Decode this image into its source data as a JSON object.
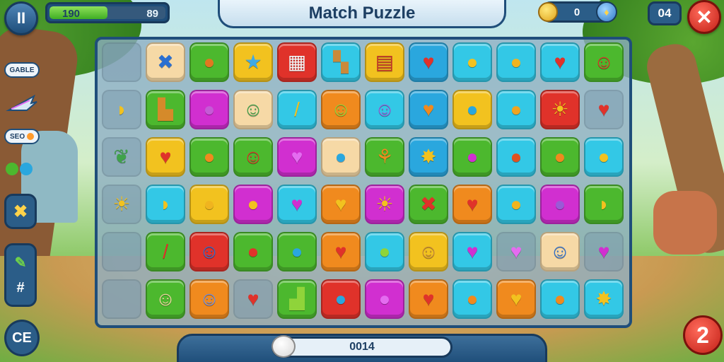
{
  "header": {
    "title": "Match Puzzle",
    "pause_label": "II",
    "progress": {
      "current": "190",
      "max": "89",
      "fill_fraction": 0.5
    },
    "coins": "0",
    "moves": "04",
    "close_label": "✕"
  },
  "sidebar": {
    "pill_top": "GABLE",
    "pill_mid": "SEO",
    "btn_lower_label": "CE"
  },
  "footer": {
    "score": "0014",
    "level": "2"
  },
  "colors": {
    "accent": "#1f4e7a",
    "red": "#e0322a",
    "green": "#4cb82e",
    "yellow": "#f2c21f",
    "blue": "#2aa7de",
    "cyan": "#33c8e6",
    "orange": "#f08a1e",
    "magenta": "#d12fd0",
    "peach": "#f6d9a6",
    "lime": "#8fd43a"
  },
  "board": {
    "cols": 12,
    "rows": [
      [
        {
          "bg": "empty"
        },
        {
          "bg": "peach",
          "icon": "✖",
          "c": "#2a6fd1",
          "name": "cross-icon"
        },
        {
          "bg": "green",
          "icon": "●",
          "c": "#e07820",
          "name": "orange-candy-icon"
        },
        {
          "bg": "yellow",
          "icon": "★",
          "c": "#3fa9e6",
          "name": "star-icon"
        },
        {
          "bg": "red",
          "icon": "▦",
          "c": "#f4f4f4",
          "name": "crate-icon"
        },
        {
          "bg": "cyan",
          "icon": "▚",
          "c": "#c98a3a",
          "name": "map-icon"
        },
        {
          "bg": "yellow",
          "icon": "▤",
          "c": "#c2342a",
          "name": "chest-icon"
        },
        {
          "bg": "blue",
          "icon": "♥",
          "c": "#e0322a",
          "name": "heart-icon"
        },
        {
          "bg": "cyan",
          "icon": "●",
          "c": "#f2c21f",
          "name": "yellow-candy-icon"
        },
        {
          "bg": "cyan",
          "icon": "●",
          "c": "#f0b41f",
          "name": "lemon-icon"
        },
        {
          "bg": "cyan",
          "icon": "♥",
          "c": "#e0322a",
          "name": "heart-icon"
        },
        {
          "bg": "green",
          "icon": "☺",
          "c": "#e0322a",
          "name": "red-creature-icon"
        }
      ],
      [
        {
          "bg": "empty",
          "icon": "◗",
          "c": "#f2c21f",
          "name": "banana-icon"
        },
        {
          "bg": "green",
          "icon": "▙",
          "c": "#d58a2a",
          "name": "bucket-icon"
        },
        {
          "bg": "magenta",
          "icon": "●",
          "c": "#c55bd6",
          "name": "lollipop-icon"
        },
        {
          "bg": "peach",
          "icon": "☺",
          "c": "#3fa34a",
          "name": "green-creature-icon"
        },
        {
          "bg": "cyan",
          "icon": "/",
          "c": "#f2c21f",
          "name": "pencil-icon"
        },
        {
          "bg": "orange",
          "icon": "☺",
          "c": "#8fd43a",
          "name": "lime-creature-icon"
        },
        {
          "bg": "cyan",
          "icon": "☺",
          "c": "#9a5ad6",
          "name": "purple-creature-icon"
        },
        {
          "bg": "blue",
          "icon": "♥",
          "c": "#f08a1e",
          "name": "orange-heart-icon"
        },
        {
          "bg": "yellow",
          "icon": "●",
          "c": "#2aa7de",
          "name": "blue-lollipop-icon"
        },
        {
          "bg": "cyan",
          "icon": "●",
          "c": "#f0a41f",
          "name": "orange-candy-icon"
        },
        {
          "bg": "red",
          "icon": "☀",
          "c": "#f2c21f",
          "name": "sun-icon"
        },
        {
          "bg": "empty",
          "icon": "♥",
          "c": "#e0322a",
          "name": "heart-icon"
        }
      ],
      [
        {
          "bg": "empty",
          "icon": "❦",
          "c": "#3fa34a",
          "name": "flower-icon"
        },
        {
          "bg": "yellow",
          "icon": "♥",
          "c": "#e0322a",
          "name": "heart-icon"
        },
        {
          "bg": "green",
          "icon": "●",
          "c": "#f08a1e",
          "name": "orange-icon"
        },
        {
          "bg": "green",
          "icon": "☺",
          "c": "#e0322a",
          "name": "red-creature-icon"
        },
        {
          "bg": "magenta",
          "icon": "♥",
          "c": "#e46cf0",
          "name": "pink-heart-icon"
        },
        {
          "bg": "peach",
          "icon": "●",
          "c": "#2aa7de",
          "name": "blue-candy-icon"
        },
        {
          "bg": "green",
          "icon": "⚘",
          "c": "#f08a1e",
          "name": "leaf-icon"
        },
        {
          "bg": "blue",
          "icon": "✸",
          "c": "#f2c21f",
          "name": "yellow-burst-icon"
        },
        {
          "bg": "green",
          "icon": "●",
          "c": "#d12fd0",
          "name": "magenta-lollipop-icon"
        },
        {
          "bg": "cyan",
          "icon": "●",
          "c": "#e0521f",
          "name": "orange-lollipop-icon"
        },
        {
          "bg": "green",
          "icon": "●",
          "c": "#f08a1e",
          "name": "orange-candy-icon"
        },
        {
          "bg": "cyan",
          "icon": "●",
          "c": "#f2c21f",
          "name": "lemon-icon"
        }
      ],
      [
        {
          "bg": "empty",
          "icon": "☀",
          "c": "#f2c21f",
          "name": "sun-icon"
        },
        {
          "bg": "cyan",
          "icon": "◗",
          "c": "#f2c21f",
          "name": "banana-icon"
        },
        {
          "bg": "yellow",
          "icon": "●",
          "c": "#f0b41f",
          "name": "bell-icon"
        },
        {
          "bg": "magenta",
          "icon": "●",
          "c": "#f2c21f",
          "name": "apple-icon"
        },
        {
          "bg": "cyan",
          "icon": "♥",
          "c": "#d12fd0",
          "name": "pink-heart-icon"
        },
        {
          "bg": "orange",
          "icon": "♥",
          "c": "#f2c21f",
          "name": "yellow-heart-icon"
        },
        {
          "bg": "magenta",
          "icon": "☀",
          "c": "#f2c21f",
          "name": "sun-icon"
        },
        {
          "bg": "green",
          "icon": "✖",
          "c": "#e0322a",
          "name": "cross-icon"
        },
        {
          "bg": "orange",
          "icon": "♥",
          "c": "#e0322a",
          "name": "heart-icon"
        },
        {
          "bg": "cyan",
          "icon": "●",
          "c": "#f0b41f",
          "name": "lemon-icon"
        },
        {
          "bg": "magenta",
          "icon": "●",
          "c": "#9a5ad6",
          "name": "grapes-icon"
        },
        {
          "bg": "green",
          "icon": "◗",
          "c": "#f2c21f",
          "name": "banana-icon"
        }
      ],
      [
        {
          "bg": "empty"
        },
        {
          "bg": "green",
          "icon": "/",
          "c": "#e0322a",
          "name": "pencil-icon"
        },
        {
          "bg": "red",
          "icon": "☺",
          "c": "#2a6fd1",
          "name": "blue-creature-icon"
        },
        {
          "bg": "green",
          "icon": "●",
          "c": "#e0322a",
          "name": "red-lollipop-icon"
        },
        {
          "bg": "green",
          "icon": "●",
          "c": "#2aa7de",
          "name": "blue-lollipop-icon"
        },
        {
          "bg": "orange",
          "icon": "♥",
          "c": "#e0322a",
          "name": "heart-icon"
        },
        {
          "bg": "cyan",
          "icon": "●",
          "c": "#8fd43a",
          "name": "green-lollipop-icon"
        },
        {
          "bg": "yellow",
          "icon": "☺",
          "c": "#c98a3a",
          "name": "brown-creature-icon"
        },
        {
          "bg": "cyan",
          "icon": "♥",
          "c": "#d12fd0",
          "name": "pink-heart-icon"
        },
        {
          "bg": "empty",
          "icon": "♥",
          "c": "#e46cf0",
          "name": "pink-heart-icon"
        },
        {
          "bg": "peach",
          "icon": "☺",
          "c": "#2a6fd1",
          "name": "blue-creature-icon"
        },
        {
          "bg": "empty",
          "icon": "♥",
          "c": "#d12fd0",
          "name": "pink-heart-icon"
        }
      ],
      [
        {
          "bg": "empty"
        },
        {
          "bg": "green",
          "icon": "☺",
          "c": "#f6d9a6",
          "name": "fox-creature-icon"
        },
        {
          "bg": "orange",
          "icon": "☺",
          "c": "#6c8fe6",
          "name": "blue-creature-icon"
        },
        {
          "bg": "empty",
          "icon": "♥",
          "c": "#e0322a",
          "name": "heart-icon"
        },
        {
          "bg": "green",
          "icon": "▟",
          "c": "#8fd43a",
          "name": "cup-icon"
        },
        {
          "bg": "red",
          "icon": "●",
          "c": "#2aa7de",
          "name": "blue-candy-icon"
        },
        {
          "bg": "magenta",
          "icon": "●",
          "c": "#e46cf0",
          "name": "pink-candy-icon"
        },
        {
          "bg": "orange",
          "icon": "♥",
          "c": "#e0322a",
          "name": "heart-icon"
        },
        {
          "bg": "cyan",
          "icon": "●",
          "c": "#f08a1e",
          "name": "orange-icon"
        },
        {
          "bg": "orange",
          "icon": "♥",
          "c": "#f2c21f",
          "name": "yellow-heart-icon"
        },
        {
          "bg": "cyan",
          "icon": "●",
          "c": "#f08a1e",
          "name": "orange-candy-icon"
        },
        {
          "bg": "cyan",
          "icon": "✸",
          "c": "#f2c21f",
          "name": "yellow-burst-icon"
        }
      ]
    ]
  }
}
